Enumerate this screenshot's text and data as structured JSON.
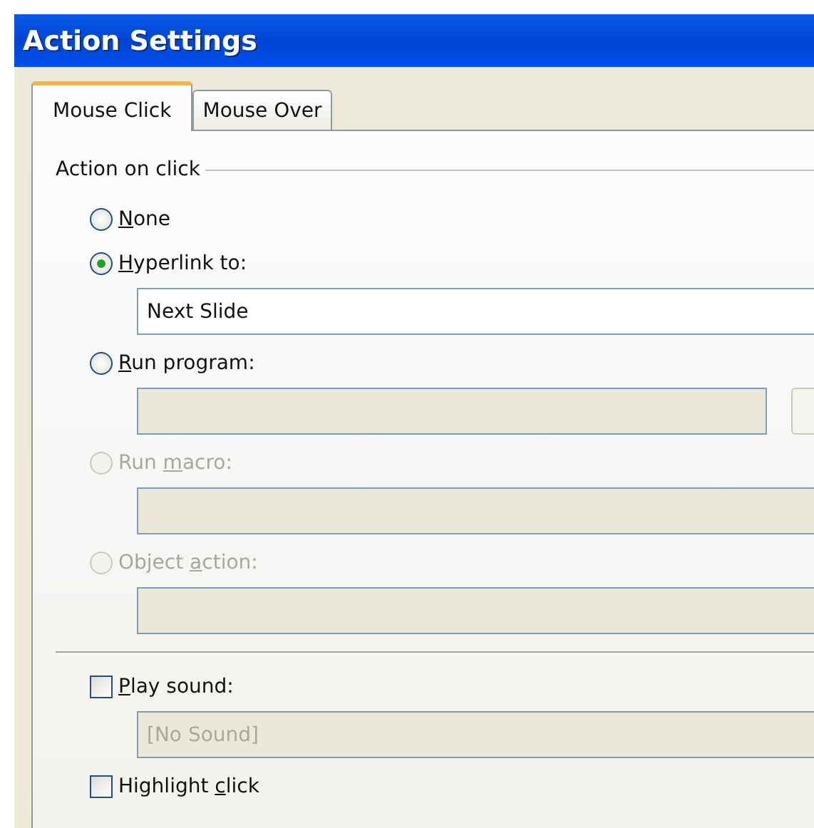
{
  "window": {
    "title": "Action Settings"
  },
  "tabs": [
    {
      "label": "Mouse Click",
      "selected": true
    },
    {
      "label": "Mouse Over",
      "selected": false
    }
  ],
  "group": {
    "title": "Action on click"
  },
  "options": [
    {
      "kind": "radio",
      "label": [
        {
          "text": "N",
          "underline": true
        },
        {
          "text": "one",
          "underline": false
        }
      ],
      "selected": false,
      "disabled": false
    },
    {
      "kind": "radio",
      "label": [
        {
          "text": "H",
          "underline": true
        },
        {
          "text": "yperlink to:",
          "underline": false
        }
      ],
      "selected": true,
      "disabled": false,
      "field": {
        "value": "Next Slide",
        "disabled": false
      }
    },
    {
      "kind": "radio",
      "label": [
        {
          "text": "R",
          "underline": true
        },
        {
          "text": "un program:",
          "underline": false
        }
      ],
      "selected": false,
      "disabled": false,
      "field": {
        "disabled": true
      },
      "browse": true
    },
    {
      "kind": "radio",
      "label": [
        {
          "text": "Run ",
          "underline": false
        },
        {
          "text": "m",
          "underline": true
        },
        {
          "text": "acro:",
          "underline": false
        }
      ],
      "selected": false,
      "disabled": true,
      "field": {
        "disabled": true
      }
    },
    {
      "kind": "radio",
      "label": [
        {
          "text": "Object ",
          "underline": false
        },
        {
          "text": "a",
          "underline": true
        },
        {
          "text": "ction:",
          "underline": false
        }
      ],
      "selected": false,
      "disabled": true,
      "field": {
        "disabled": true
      }
    },
    {
      "kind": "separator"
    },
    {
      "kind": "checkbox",
      "label": [
        {
          "text": "P",
          "underline": true
        },
        {
          "text": "lay sound:",
          "underline": false
        }
      ],
      "checked": false,
      "disabled": false,
      "field": {
        "value": "[No Sound]",
        "disabled": true
      }
    },
    {
      "kind": "checkbox",
      "label": [
        {
          "text": "Highlight ",
          "underline": false
        },
        {
          "text": "c",
          "underline": true
        },
        {
          "text": "lick",
          "underline": false
        }
      ],
      "checked": false,
      "disabled": false
    }
  ]
}
